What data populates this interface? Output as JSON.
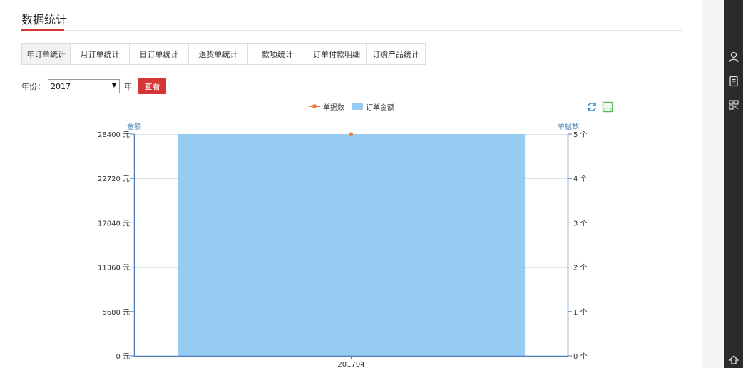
{
  "page": {
    "title": "数据统计"
  },
  "tabs": [
    {
      "label": "年订单统计"
    },
    {
      "label": "月订单统计"
    },
    {
      "label": "日订单统计"
    },
    {
      "label": "退货单统计"
    },
    {
      "label": "款项统计"
    },
    {
      "label": "订单付款明细"
    },
    {
      "label": "订购产品统计"
    }
  ],
  "filter": {
    "year_label": "年份：",
    "year_value": "2017",
    "year_unit": "年",
    "query_button": "查看"
  },
  "legend": {
    "line_label": "单据数",
    "bar_label": "订单金额"
  },
  "icons": {
    "refresh": "refresh-icon",
    "save": "save-as-image-icon",
    "rightbar": [
      "user-icon",
      "document-icon",
      "qrcode-icon",
      "back-to-top-icon"
    ]
  },
  "colors": {
    "accent": "#d63535",
    "bar": "#97ccf2",
    "line": "#ed7d4a",
    "axis": "#4a7fb5",
    "refresh": "#2f8fde",
    "save": "#5cb85c",
    "rightbar": "#2b2b2b"
  },
  "chart_data": {
    "type": "bar",
    "categories": [
      "201704"
    ],
    "series": [
      {
        "name": "订单金额",
        "type": "bar",
        "axis": "left",
        "values": [
          28400
        ]
      },
      {
        "name": "单据数",
        "type": "line",
        "axis": "right",
        "values": [
          5
        ]
      }
    ],
    "y_left": {
      "label": "金额",
      "unit": "元",
      "ticks": [
        0,
        5680,
        11360,
        17040,
        22720,
        28400
      ],
      "tick_labels": [
        "0 元",
        "5680 元",
        "11360 元",
        "17040 元",
        "22720 元",
        "28400 元"
      ],
      "range": [
        0,
        28400
      ]
    },
    "y_right": {
      "label": "单据数",
      "unit": "个",
      "ticks": [
        0,
        1,
        2,
        3,
        4,
        5
      ],
      "tick_labels": [
        "0 个",
        "1 个",
        "2 个",
        "3 个",
        "4 个",
        "5 个"
      ],
      "range": [
        0,
        5
      ]
    },
    "grid": true,
    "legend_position": "top-center"
  }
}
